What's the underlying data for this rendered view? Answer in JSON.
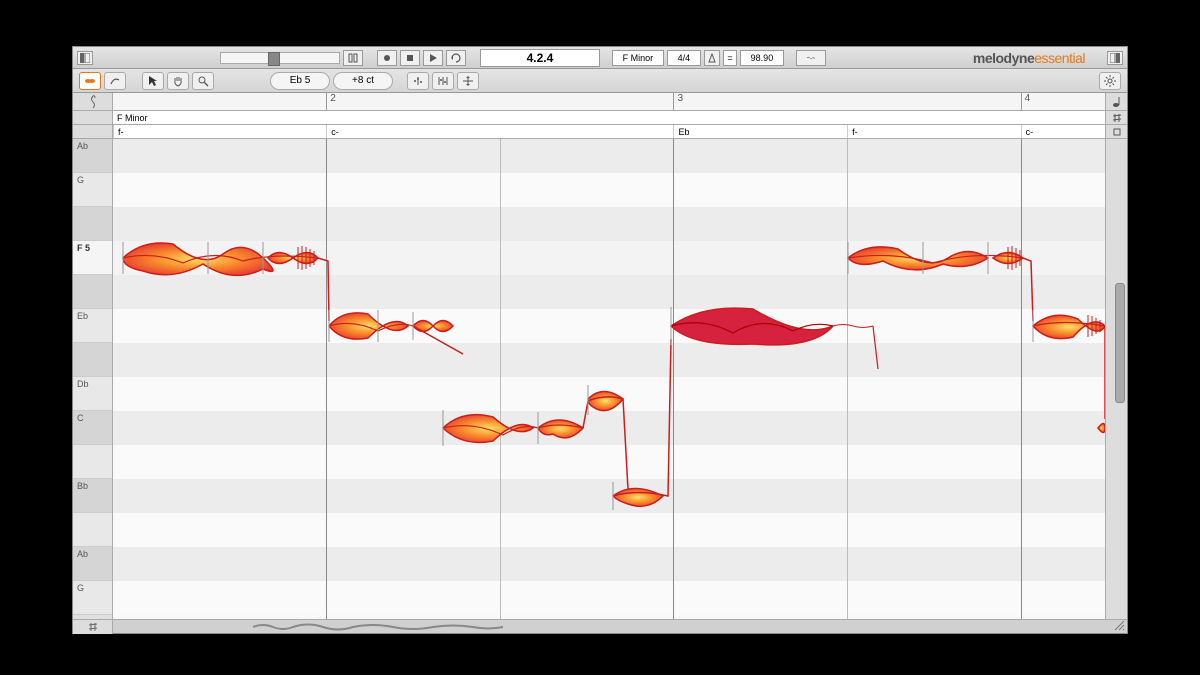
{
  "topbar": {
    "position": "4.2.4",
    "key": "F Minor",
    "time_sig": "4/4",
    "tempo": "98.90",
    "brand_main": "melodyne",
    "brand_sub": "essential"
  },
  "toolbar": {
    "pitch_display": "Eb 5",
    "cents_display": "+8 ct"
  },
  "ruler": {
    "bars": [
      "2",
      "3",
      "4"
    ]
  },
  "key_row": {
    "label": "F Minor"
  },
  "chords": [
    {
      "label": "f-",
      "left_pct": 0
    },
    {
      "label": "c-",
      "left_pct": 21.5
    },
    {
      "label": "Eb",
      "left_pct": 56.5
    },
    {
      "label": "f-",
      "left_pct": 74.0
    },
    {
      "label": "c-",
      "left_pct": 91.5
    }
  ],
  "notes": [
    {
      "name": "Ab",
      "class": "shade"
    },
    {
      "name": "G",
      "class": "white"
    },
    {
      "name": "",
      "class": "shade"
    },
    {
      "name": "F 5",
      "class": "current"
    },
    {
      "name": "",
      "class": "shade"
    },
    {
      "name": "Eb",
      "class": "white"
    },
    {
      "name": "",
      "class": "shade"
    },
    {
      "name": "Db",
      "class": "white"
    },
    {
      "name": "C",
      "class": "shade"
    },
    {
      "name": "",
      "class": "white"
    },
    {
      "name": "Bb",
      "class": "shade"
    },
    {
      "name": "",
      "class": "white"
    },
    {
      "name": "Ab",
      "class": "shade"
    },
    {
      "name": "G",
      "class": "white"
    }
  ],
  "bars": [
    {
      "pct": 21.5,
      "strong": true
    },
    {
      "pct": 39.0,
      "strong": false
    },
    {
      "pct": 56.5,
      "strong": true
    },
    {
      "pct": 74.0,
      "strong": false
    },
    {
      "pct": 91.5,
      "strong": true
    }
  ],
  "colors": {
    "blob_fill_outer": "#e62f2f",
    "blob_fill_mid": "#fa8f2e",
    "blob_fill_inner": "#ffe066",
    "blob_stroke": "#c81e1e"
  }
}
